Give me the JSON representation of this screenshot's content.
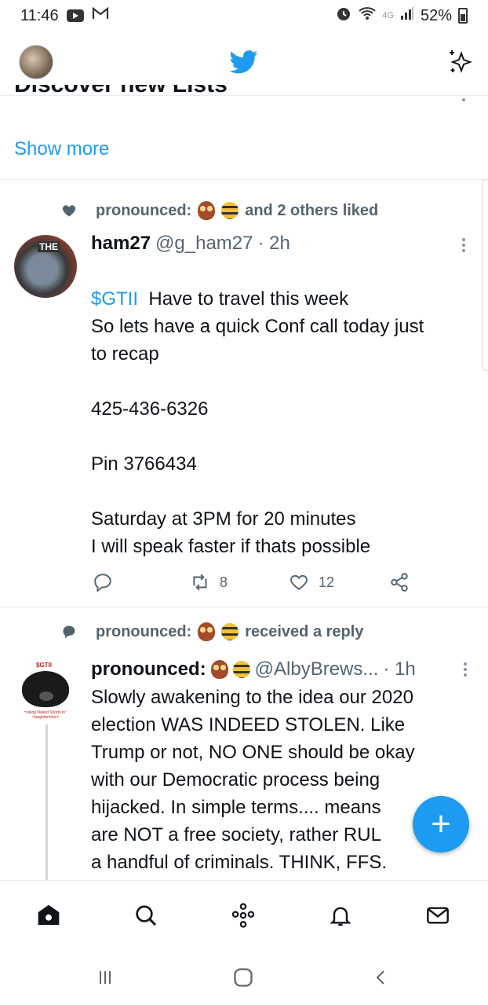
{
  "status_bar": {
    "time": "11:46",
    "battery": "52%",
    "network": "4G"
  },
  "app": {
    "logo_icon": "twitter-bird-icon",
    "sparkle_icon": "sparkle-icon",
    "brand_color": "#1d9bf0"
  },
  "discover": {
    "title": "Discover new Lists",
    "show_more": "Show more"
  },
  "tweets": [
    {
      "context_prefix": "pronounced:",
      "context_suffix": "and 2 others liked",
      "context_icon": "heart-icon",
      "name": "ham27",
      "handle": "@g_ham27",
      "time": "· 2h",
      "avatar_label": "THE",
      "cashtag": "$GTII",
      "text_first": "Have to travel this week",
      "text_rest": "So lets have a quick Conf call today just\nto recap\n\n425-436-6326\n\nPin 3766434\n\nSaturday at 3PM for 20 minutes\nI will speak faster if thats possible",
      "retweets": "8",
      "likes": "12"
    },
    {
      "context_prefix": "pronounced:",
      "context_suffix": "received a reply",
      "context_icon": "speech-bubble-icon",
      "name": "pronounced:",
      "handle": "@AlbyBrews...",
      "time": "· 1h",
      "avatar_top": "$GTII",
      "avatar_bottom": "Smoking Naked Shorts to the slaughterhouse!",
      "text": "Slowly awakening to the idea our 2020\nelection WAS INDEED STOLEN. Like\nTrump or not, NO ONE should be okay\nwith our Democratic process being\nhijacked. In simple terms.... means\nare NOT a free society, rather RUL\na handful of criminals. THINK, FFS."
    }
  ],
  "fab": {
    "label": "+"
  },
  "bottom_nav": [
    "home-icon",
    "search-icon",
    "spaces-icon",
    "notifications-icon",
    "messages-icon"
  ],
  "system_nav": [
    "recent-apps-icon",
    "home-button-icon",
    "back-icon"
  ]
}
